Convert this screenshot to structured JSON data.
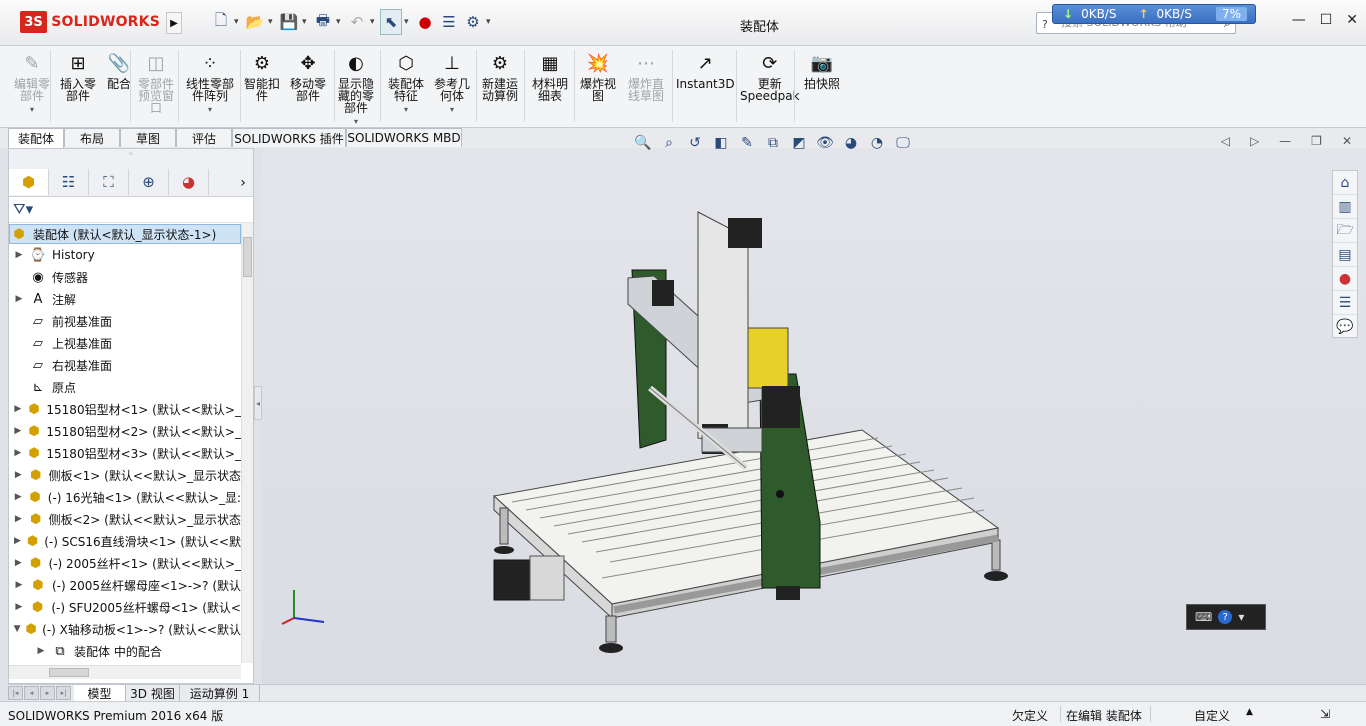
{
  "app": {
    "logo_prefix": "3S",
    "logo_text": "SOLIDWORKS",
    "doc_title": "装配体"
  },
  "network": {
    "down": "0KB/S",
    "up": "0KB/S",
    "percent": "7%"
  },
  "search": {
    "placeholder": "搜索 SOLIDWORKS 帮助"
  },
  "ribbon": {
    "buttons": [
      {
        "label": "编辑零\n部件",
        "icon": "edit-component-icon",
        "disabled": true
      },
      {
        "label": "插入零\n部件",
        "icon": "insert-component-icon"
      },
      {
        "label": "配合",
        "icon": "mate-icon"
      },
      {
        "label": "零部件\n预览窗\n口",
        "icon": "component-preview-icon",
        "disabled": true
      },
      {
        "label": "线性零部\n件阵列",
        "icon": "linear-pattern-icon"
      },
      {
        "label": "智能扣\n件",
        "icon": "smart-fastener-icon"
      },
      {
        "label": "移动零\n部件",
        "icon": "move-component-icon"
      },
      {
        "label": "显示隐\n藏的零\n部件",
        "icon": "show-hidden-icon"
      },
      {
        "label": "装配体\n特征",
        "icon": "assembly-feature-icon"
      },
      {
        "label": "参考几\n何体",
        "icon": "reference-geometry-icon"
      },
      {
        "label": "新建运\n动算例",
        "icon": "motion-study-icon"
      },
      {
        "label": "材料明\n细表",
        "icon": "bom-icon"
      },
      {
        "label": "爆炸视\n图",
        "icon": "exploded-view-icon"
      },
      {
        "label": "爆炸直\n线草图",
        "icon": "explode-line-icon",
        "disabled": true
      },
      {
        "label": "Instant3D",
        "icon": "instant3d-icon"
      },
      {
        "label": "更新\nSpeedpak",
        "icon": "speedpak-icon"
      },
      {
        "label": "拍快照",
        "icon": "snapshot-icon"
      }
    ]
  },
  "tabs": [
    "装配体",
    "布局",
    "草图",
    "评估",
    "SOLIDWORKS 插件",
    "SOLIDWORKS MBD"
  ],
  "tree": {
    "root": "装配体  (默认<默认_显示状态-1>)",
    "items": [
      {
        "label": "History",
        "icon": "history-icon",
        "twisty": "▶"
      },
      {
        "label": "传感器",
        "icon": "sensor-icon",
        "twisty": ""
      },
      {
        "label": "注解",
        "icon": "annotation-icon",
        "twisty": "▶"
      },
      {
        "label": "前视基准面",
        "icon": "plane-icon",
        "twisty": ""
      },
      {
        "label": "上视基准面",
        "icon": "plane-icon",
        "twisty": ""
      },
      {
        "label": "右视基准面",
        "icon": "plane-icon",
        "twisty": ""
      },
      {
        "label": "原点",
        "icon": "origin-icon",
        "twisty": ""
      },
      {
        "label": "15180铝型材<1> (默认<<默认>_",
        "icon": "part-icon",
        "twisty": "▶"
      },
      {
        "label": "15180铝型材<2> (默认<<默认>_",
        "icon": "part-icon",
        "twisty": "▶"
      },
      {
        "label": "15180铝型材<3> (默认<<默认>_",
        "icon": "part-icon",
        "twisty": "▶"
      },
      {
        "label": "侧板<1> (默认<<默认>_显示状态",
        "icon": "part-icon",
        "twisty": "▶"
      },
      {
        "label": "(-) 16光轴<1> (默认<<默认>_显:",
        "icon": "part-icon",
        "twisty": "▶"
      },
      {
        "label": "侧板<2> (默认<<默认>_显示状态",
        "icon": "part-icon",
        "twisty": "▶"
      },
      {
        "label": "(-) SCS16直线滑块<1> (默认<<默",
        "icon": "part-icon",
        "twisty": "▶"
      },
      {
        "label": "(-) 2005丝杆<1> (默认<<默认>_",
        "icon": "part-icon",
        "twisty": "▶"
      },
      {
        "label": "(-) 2005丝杆螺母座<1>->? (默认",
        "icon": "part-icon",
        "twisty": "▶"
      },
      {
        "label": "(-) SFU2005丝杆螺母<1> (默认<",
        "icon": "part-icon",
        "twisty": "▶"
      },
      {
        "label": "(-) X轴移动板<1>->? (默认<<默认",
        "icon": "part-icon",
        "twisty": "▼"
      },
      {
        "label": "装配体 中的配合",
        "icon": "mates-folder-icon",
        "twisty": "▶",
        "indent": true
      }
    ]
  },
  "bottom_tabs": [
    "模型",
    "3D 视图",
    "运动算例 1"
  ],
  "status": {
    "product": "SOLIDWORKS Premium 2016 x64 版",
    "definition": "欠定义",
    "editing": "在编辑 装配体",
    "units": "自定义"
  },
  "colors": {
    "brand": "#d9261c",
    "viewport_bg": "#dfe2e7",
    "frame_green": "#2f5a2b",
    "plate_gray": "#cfd3d8",
    "table_white": "#f4f4f2"
  }
}
